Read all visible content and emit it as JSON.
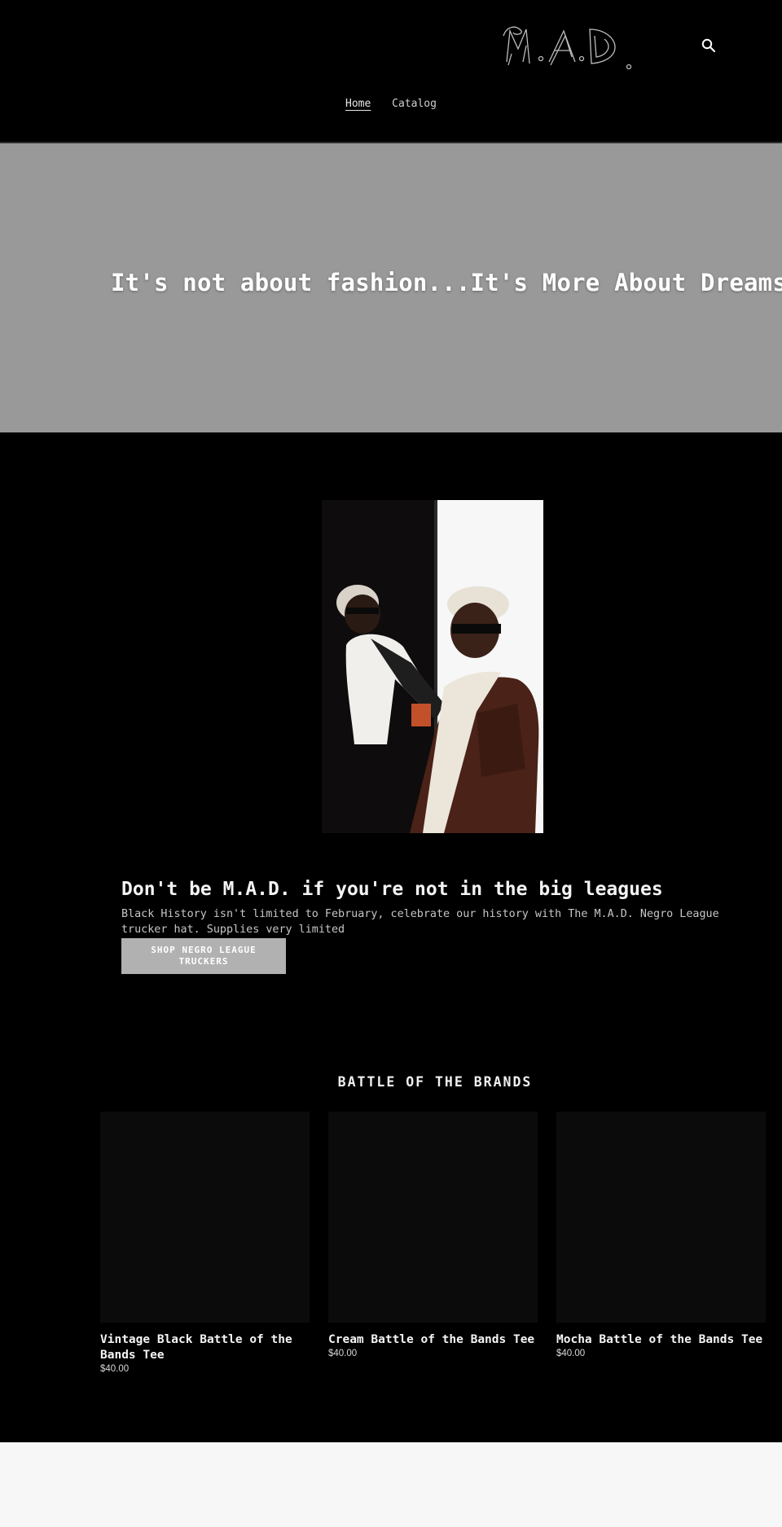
{
  "header": {
    "logo_alt": "M.A.D.",
    "nav": [
      {
        "label": "Home"
      },
      {
        "label": "Catalog"
      }
    ]
  },
  "hero": {
    "headline": "It's not about fashion...It's More About Dreams."
  },
  "feature": {
    "title": "Don't be M.A.D. if you're not in the big leagues",
    "body": "Black History isn't limited to February, celebrate our history with The M.A.D. Negro League trucker hat. Supplies very limited",
    "cta_label": "SHOP NEGRO LEAGUE TRUCKERS"
  },
  "collection": {
    "title": "BATTLE OF THE BRANDS",
    "products": [
      {
        "name": "Vintage Black Battle of the Bands Tee",
        "price": "$40.00"
      },
      {
        "name": "Cream Battle of the Bands Tee",
        "price": "$40.00"
      },
      {
        "name": "Mocha Battle of the Bands Tee",
        "price": "$40.00"
      }
    ]
  },
  "colors": {
    "page_bg": "#000000",
    "hero_bg": "#999999",
    "button_bg": "#b1b1b1",
    "footer_bg": "#f7f7f7"
  }
}
